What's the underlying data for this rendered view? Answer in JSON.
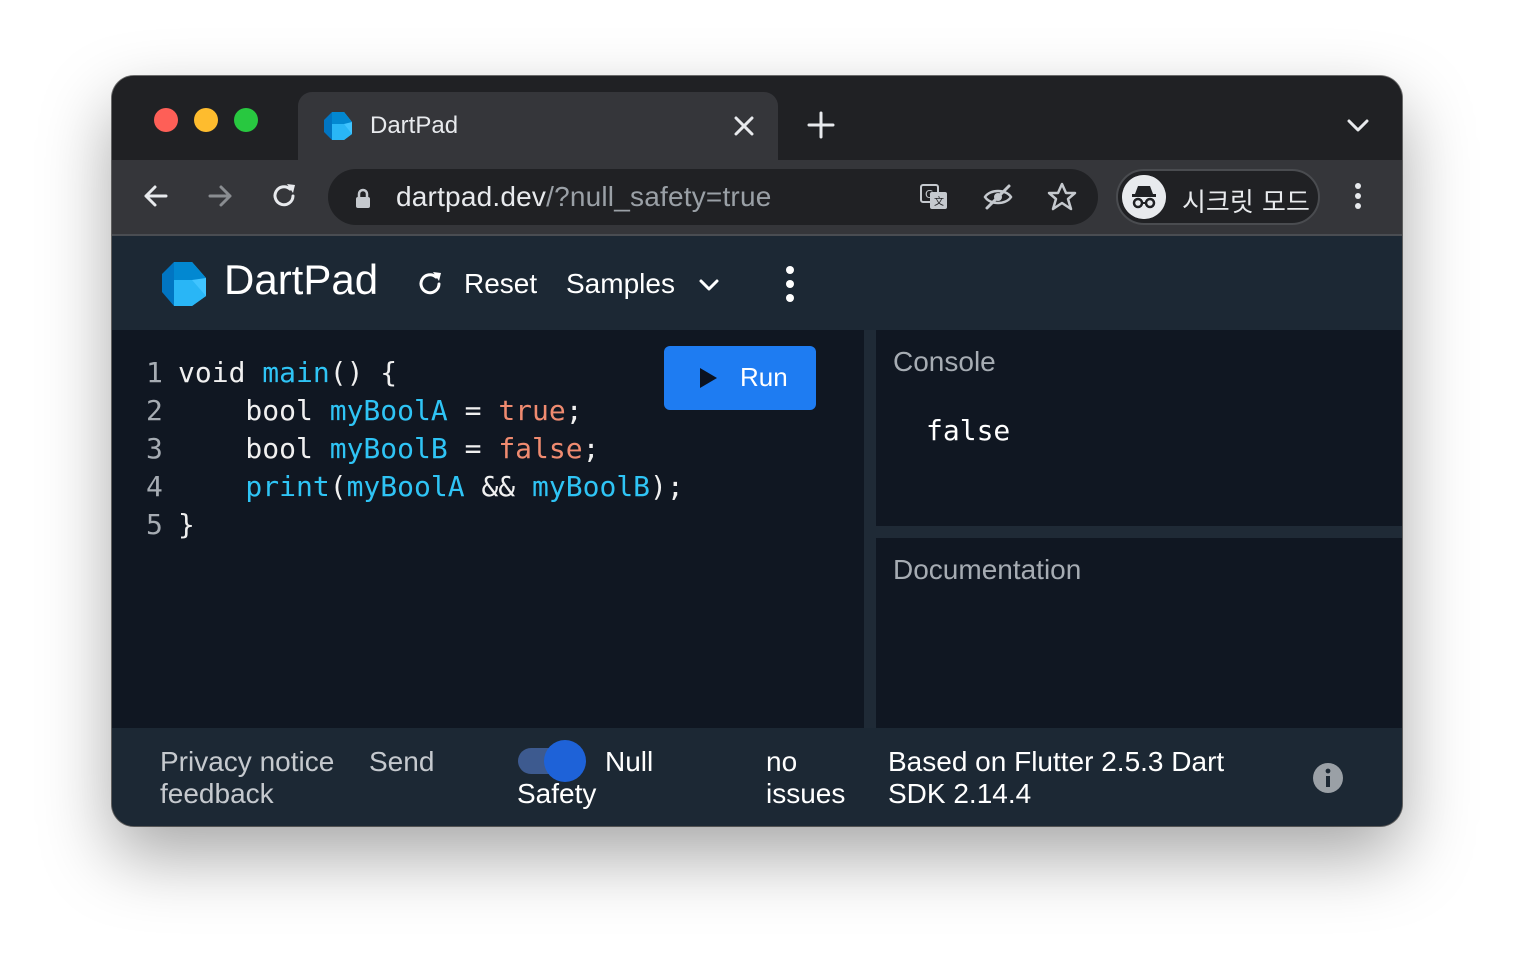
{
  "browser": {
    "tab": {
      "title": "DartPad"
    },
    "url": {
      "host": "dartpad.dev",
      "path": "/?null_safety=true"
    },
    "incognito_label": "시크릿 모드"
  },
  "app": {
    "title": "DartPad",
    "reset_label": "Reset",
    "samples_label": "Samples",
    "run_label": "Run"
  },
  "editor": {
    "lines": [
      {
        "num": "1",
        "tokens": [
          [
            "k",
            "void "
          ],
          [
            "f",
            "main"
          ],
          [
            "p",
            "() {"
          ]
        ]
      },
      {
        "num": "2",
        "tokens": [
          [
            "k",
            "    bool "
          ],
          [
            "f",
            "myBoolA"
          ],
          [
            "p",
            " = "
          ],
          [
            "b",
            "true"
          ],
          [
            "p",
            ";"
          ]
        ]
      },
      {
        "num": "3",
        "tokens": [
          [
            "k",
            "    bool "
          ],
          [
            "f",
            "myBoolB"
          ],
          [
            "p",
            " = "
          ],
          [
            "b",
            "false"
          ],
          [
            "p",
            ";"
          ]
        ]
      },
      {
        "num": "4",
        "tokens": [
          [
            "f",
            "    print"
          ],
          [
            "p",
            "("
          ],
          [
            "f",
            "myBoolA"
          ],
          [
            "p",
            " && "
          ],
          [
            "f",
            "myBoolB"
          ],
          [
            "p",
            ");"
          ]
        ]
      },
      {
        "num": "5",
        "tokens": [
          [
            "p",
            "}"
          ]
        ]
      }
    ]
  },
  "console": {
    "title": "Console",
    "output": "false"
  },
  "documentation": {
    "title": "Documentation"
  },
  "footer": {
    "privacy_line1": "Privacy notice",
    "privacy_line2": "feedback",
    "send": "Send",
    "null_line1": "Null",
    "null_line2": "Safety",
    "issues_line1": "no",
    "issues_line2": "issues",
    "version_line1": "Based on Flutter 2.5.3 Dart",
    "version_line2": "SDK 2.14.4"
  },
  "colors": {
    "accent": "#1e7cf2",
    "function": "#2fc4f5",
    "boolean": "#f08b70",
    "editor_bg": "#101722",
    "appbar_bg": "#1c2834"
  }
}
